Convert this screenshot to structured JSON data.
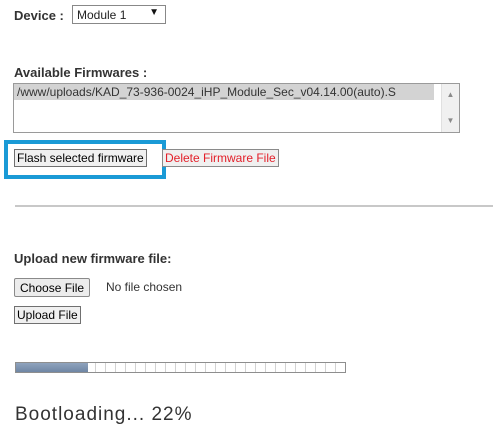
{
  "device": {
    "label": "Device :",
    "selected": "Module 1",
    "arrow_icon": "dropdown-triangle-icon"
  },
  "firmwares": {
    "label": "Available Firmwares :",
    "items": [
      "/www/uploads/KAD_73-936-0024_iHP_Module_Sec_v04.14.00(auto).S"
    ],
    "selected_index": 0,
    "scroll_up_icon": "scroll-up-arrow-icon",
    "scroll_down_icon": "scroll-down-arrow-icon"
  },
  "actions": {
    "flash_label": "Flash selected firmware",
    "delete_label": "Delete Firmware File",
    "delete_color": "#e3202a",
    "highlight_color": "#1a9ad6"
  },
  "upload": {
    "label": "Upload new firmware file:",
    "choose_label": "Choose File",
    "no_file_text": "No file chosen",
    "upload_label": "Upload File"
  },
  "progress": {
    "fraction": 0.22,
    "status_text": "Bootloading... 22%"
  }
}
